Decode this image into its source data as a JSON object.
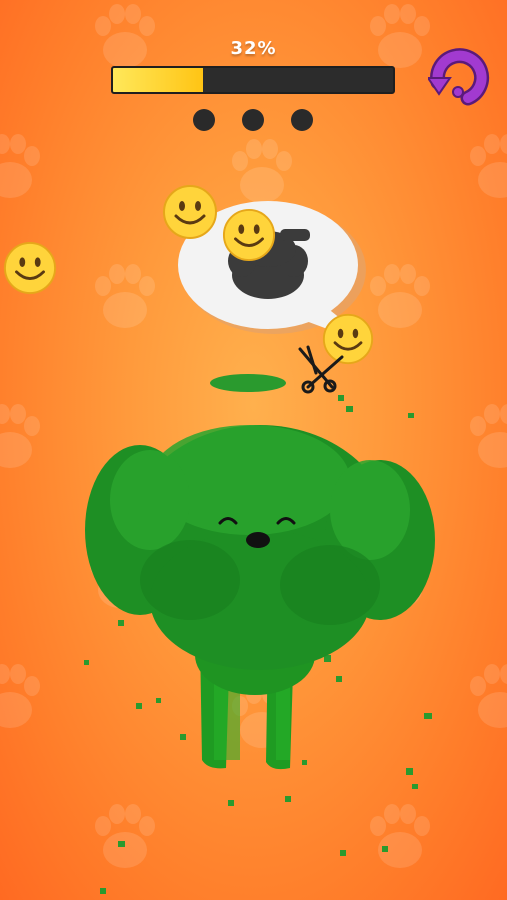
{
  "hud": {
    "progress_label": "32%",
    "progress_fraction": 0.32,
    "stage_dots": 3
  },
  "icons": {
    "restart": "restart-arrow-icon",
    "scissors": "scissors-icon",
    "emoji": "smiley-face-icon",
    "paw": "paw-print-icon"
  },
  "colors": {
    "background": "#ff8a30",
    "progress_fill": "#ffd426",
    "progress_track": "#2c2c2c",
    "restart_button": "#8e2fb8",
    "fur": "#1f9a2a",
    "emoji": "#ffd43b"
  }
}
